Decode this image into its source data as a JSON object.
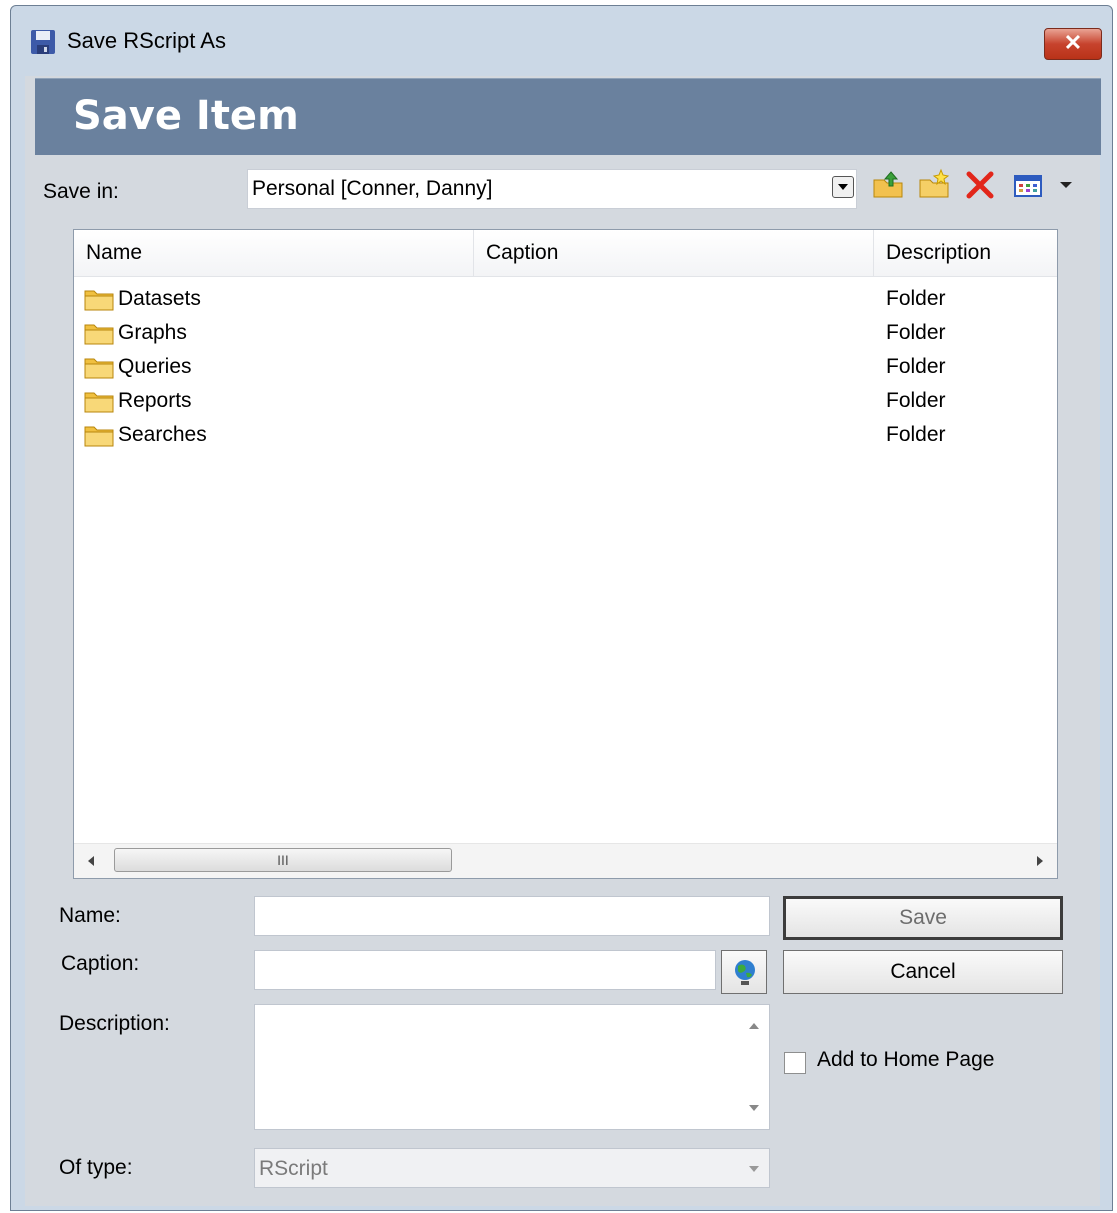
{
  "window": {
    "title": "Save RScript As",
    "close_label": "✕"
  },
  "banner": {
    "title": "Save Item"
  },
  "save_in": {
    "label": "Save in:",
    "value": "Personal [Conner, Danny]"
  },
  "toolbar": {
    "icons": [
      "up-folder-icon",
      "new-folder-icon",
      "delete-icon",
      "view-menu-icon",
      "dropdown-arrow-icon"
    ]
  },
  "list": {
    "columns": [
      "Name",
      "Caption",
      "Description"
    ],
    "rows": [
      {
        "name": "Datasets",
        "caption": "",
        "description": "Folder"
      },
      {
        "name": "Graphs",
        "caption": "",
        "description": "Folder"
      },
      {
        "name": "Queries",
        "caption": "",
        "description": "Folder"
      },
      {
        "name": "Reports",
        "caption": "",
        "description": "Folder"
      },
      {
        "name": "Searches",
        "caption": "",
        "description": "Folder"
      }
    ],
    "scroll_thumb_label": "III"
  },
  "form": {
    "name_label": "Name:",
    "name_value": "",
    "caption_label": "Caption:",
    "caption_value": "",
    "description_label": "Description:",
    "description_value": "",
    "type_label": "Of type:",
    "type_value": "RScript"
  },
  "buttons": {
    "save": "Save",
    "cancel": "Cancel"
  },
  "home_page": {
    "label": "Add to Home Page",
    "checked": false
  }
}
